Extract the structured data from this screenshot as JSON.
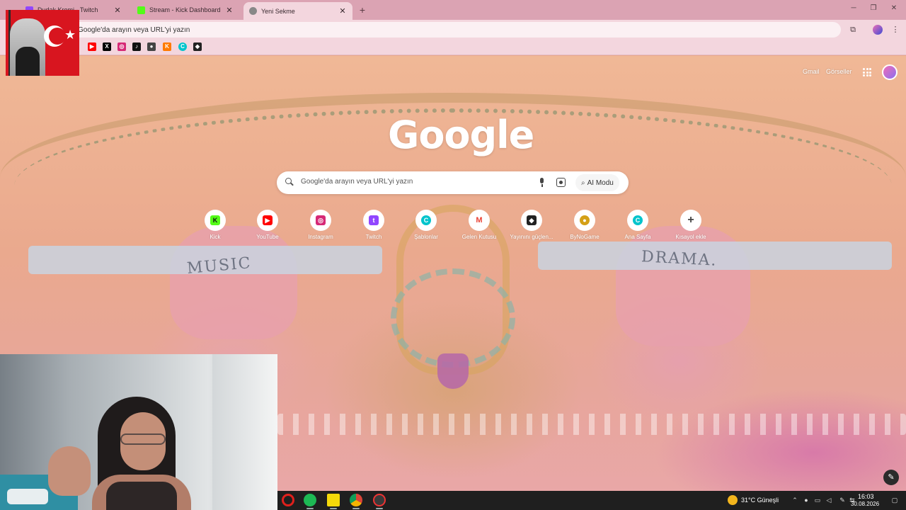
{
  "browser": {
    "tabs": [
      {
        "title": "Dudak Kremi - Twitch",
        "favicon_color": "#9146ff",
        "active": false
      },
      {
        "title": "Stream - Kick Dashboard",
        "favicon_color": "#53fc18",
        "active": false
      },
      {
        "title": "Yeni Sekme",
        "favicon_color": "#888888",
        "active": true
      }
    ],
    "omnibox_placeholder": "Google'da arayın veya URL'yi yazın",
    "bookmarks": [
      {
        "icon": "youtube-icon",
        "color": "#ff0000"
      },
      {
        "icon": "x-icon",
        "color": "#000000"
      },
      {
        "icon": "instagram-icon",
        "color": "#d62976"
      },
      {
        "icon": "tiktok-icon",
        "color": "#111111"
      },
      {
        "icon": "botrix-icon",
        "color": "#444444"
      },
      {
        "icon": "kofi-icon",
        "color": "#ff7a00"
      },
      {
        "icon": "canva-icon",
        "color": "#00c4cc"
      },
      {
        "icon": "streamelements-icon",
        "color": "#222222"
      }
    ]
  },
  "ntp": {
    "header_links": {
      "gmail": "Gmail",
      "images": "Görseller"
    },
    "logo": "Google",
    "search_placeholder": "Google'da arayın veya URL'yi yazın",
    "ai_mode_label": "AI Modu",
    "doodle_ribbons": {
      "left": "MUSIC",
      "right": "DRAMA."
    },
    "shortcuts": [
      {
        "label": "Kick",
        "glyph": "K",
        "color": "#53fc18"
      },
      {
        "label": "YouTube",
        "glyph": "▶",
        "color": "#ff0000"
      },
      {
        "label": "Instagram",
        "glyph": "◎",
        "color": "#d62976"
      },
      {
        "label": "Twitch",
        "glyph": "t",
        "color": "#9146ff"
      },
      {
        "label": "Şablonlar",
        "glyph": "C",
        "color": "#00c4cc"
      },
      {
        "label": "Gelen Kutusu",
        "glyph": "M",
        "color": "#ea4335"
      },
      {
        "label": "Yayınını güçlen...",
        "glyph": "◆",
        "color": "#222222"
      },
      {
        "label": "ByNoGame",
        "glyph": "●",
        "color": "#d4a017"
      },
      {
        "label": "Ana Sayfa",
        "glyph": "C",
        "color": "#00c4cc"
      },
      {
        "label": "Kısayol ekle",
        "glyph": "+",
        "color": "#555555"
      }
    ]
  },
  "taskbar": {
    "weather": "31°C  Güneşli",
    "time": "16:03",
    "date": "30.08.2026",
    "apps": [
      {
        "icon": "opera-icon",
        "color": "#e0201c"
      },
      {
        "icon": "spotify-icon",
        "color": "#1db954"
      },
      {
        "icon": "sticky-notes-icon",
        "color": "#f5d90a"
      },
      {
        "icon": "chrome-icon",
        "color": "#db4437"
      },
      {
        "icon": "obs-icon",
        "color": "#3a3a3a"
      }
    ]
  }
}
